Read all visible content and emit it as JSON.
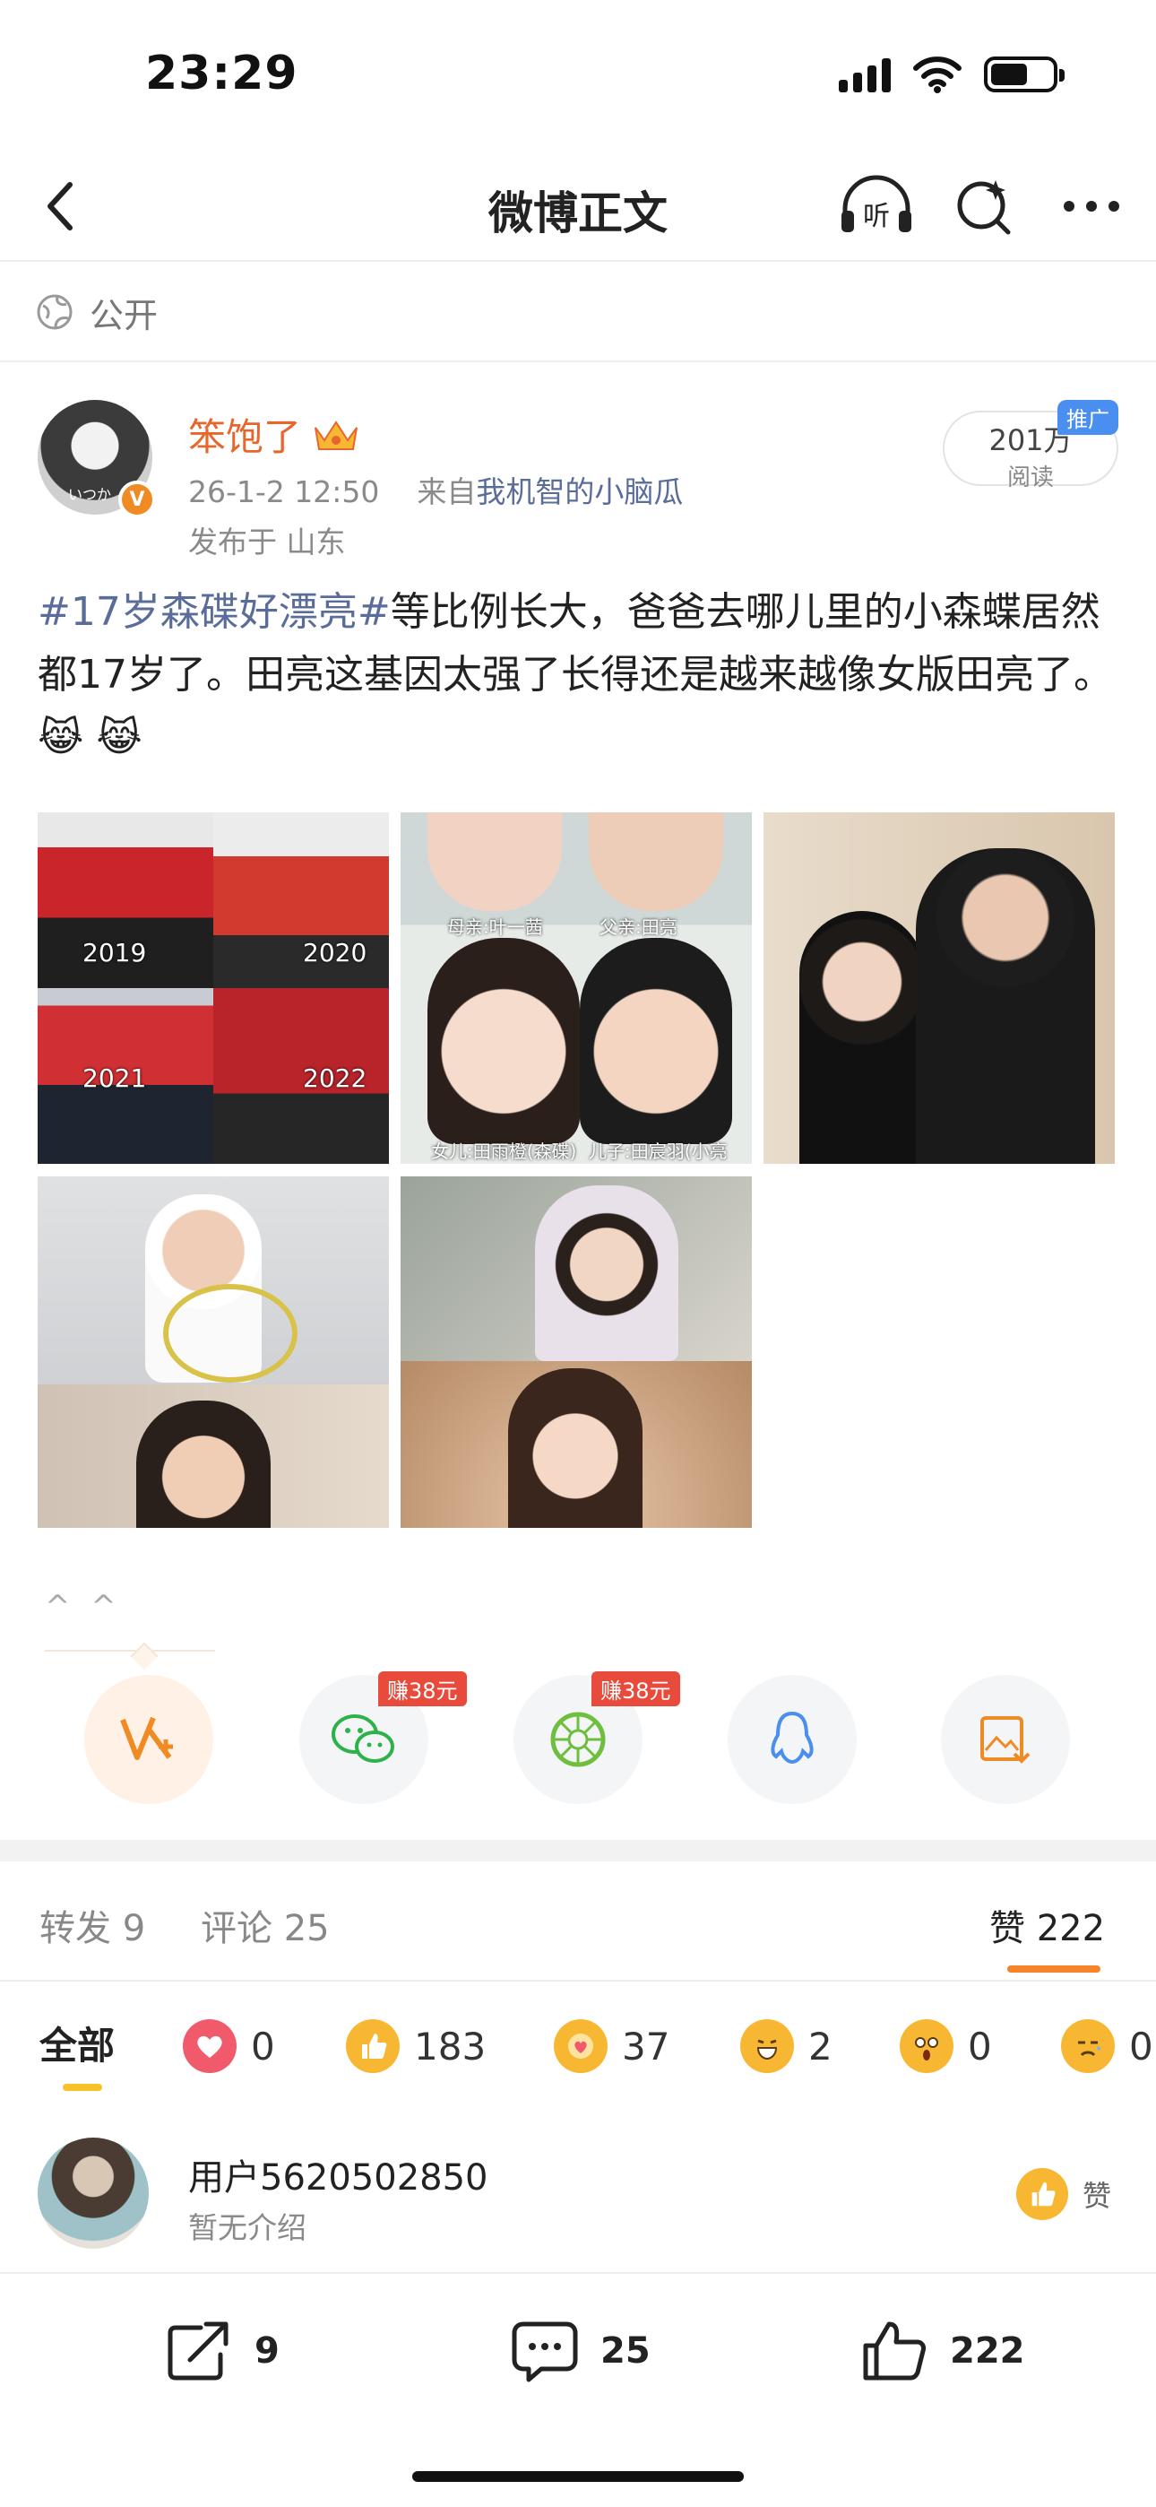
{
  "status_bar": {
    "time": "23:29"
  },
  "nav": {
    "title": "微博正文",
    "listen_label": "听"
  },
  "visibility": {
    "label": "公开"
  },
  "author": {
    "name": "笨饱了",
    "date": "26-1-2 12:50",
    "source_prefix": "来自",
    "source": "我机智的小脑瓜",
    "location": "发布于 山东",
    "avatar_text": "いつか",
    "reads_count": "201万",
    "reads_label": "阅读",
    "promo_tag": "推广"
  },
  "post": {
    "hashtag": "#17岁森碟好漂亮#",
    "body": "等比例长大，爸爸去哪儿里的小森蝶居然都17岁了。田亮这基因太强了长得还是越来越像女版田亮了。",
    "emoji": "😹 😹"
  },
  "images": {
    "tile1_years": [
      "2019",
      "2020",
      "2021",
      "2022"
    ],
    "tile2_labels": [
      "母亲:叶一茜",
      "父亲:田亮",
      "女儿:田雨橙(森碟)",
      "儿子:田宸羽(小亮仔)"
    ]
  },
  "share": {
    "collapse": "^ ^",
    "earn_badge_1": "赚38元",
    "earn_badge_2": "赚38元"
  },
  "stats": {
    "repost_label": "转发",
    "repost_count": "9",
    "comment_label": "评论",
    "comment_count": "25",
    "like_label": "赞",
    "like_count": "222"
  },
  "reactions": {
    "all_label": "全部",
    "items": [
      {
        "icon": "heart-icon",
        "count": "0",
        "color": "#f05a6a"
      },
      {
        "icon": "thumbs-up-icon",
        "count": "183",
        "color": "#f7b733"
      },
      {
        "icon": "hug-icon",
        "count": "37",
        "color": "#f7b733"
      },
      {
        "icon": "laugh-icon",
        "count": "2",
        "color": "#f7b733"
      },
      {
        "icon": "surprised-icon",
        "count": "0",
        "color": "#f7b733"
      },
      {
        "icon": "sad-icon",
        "count": "0",
        "color": "#f7b733"
      }
    ]
  },
  "liker": {
    "name": "用户5620502850",
    "bio": "暂无介绍",
    "like_label": "赞"
  },
  "bottom_bar": {
    "repost_count": "9",
    "comment_count": "25",
    "like_count": "222"
  },
  "colors": {
    "accent": "#f5842a",
    "author_name": "#e8662b",
    "link": "#5a6c9a"
  }
}
